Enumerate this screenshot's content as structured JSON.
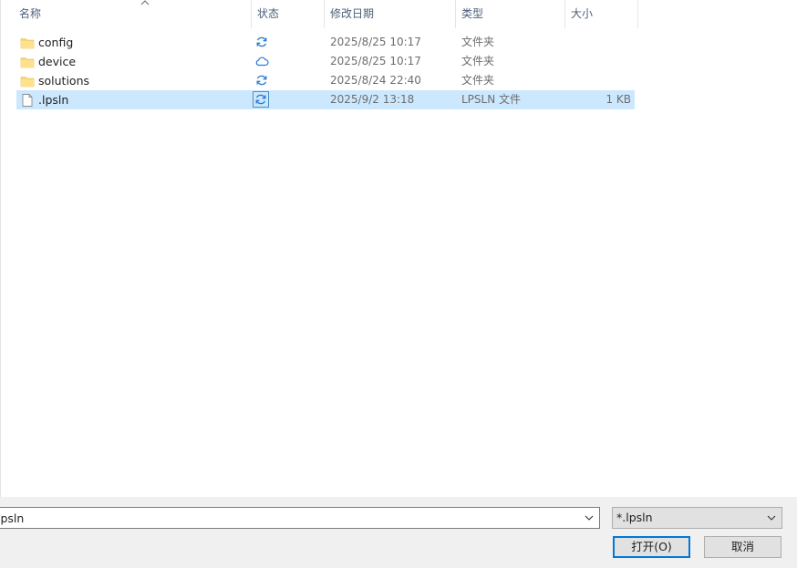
{
  "columns": {
    "name": "名称",
    "status": "状态",
    "modified": "修改日期",
    "type": "类型",
    "size": "大小"
  },
  "files": [
    {
      "name": "config",
      "icon": "folder-icon",
      "status": "sync-icon",
      "modified": "2025/8/25 10:17",
      "type": "文件夹",
      "size": ""
    },
    {
      "name": "device",
      "icon": "folder-icon",
      "status": "cloud-icon",
      "modified": "2025/8/25 10:17",
      "type": "文件夹",
      "size": ""
    },
    {
      "name": "solutions",
      "icon": "folder-icon",
      "status": "sync-icon",
      "modified": "2025/8/24 22:40",
      "type": "文件夹",
      "size": ""
    },
    {
      "name": ".lpsln",
      "icon": "file-icon",
      "status": "sync-icon",
      "modified": "2025/9/2 13:18",
      "type": "LPSLN 文件",
      "size": "1 KB",
      "selected": true
    }
  ],
  "filename_input": {
    "value": ".lpsln"
  },
  "filter": {
    "value": "*.lpsln"
  },
  "buttons": {
    "open": "打开(O)",
    "cancel": "取消"
  },
  "colors": {
    "selection": "#cce8ff",
    "accent": "#0078d7",
    "folder": "#f8d775",
    "sync": "#2b7bd3"
  }
}
